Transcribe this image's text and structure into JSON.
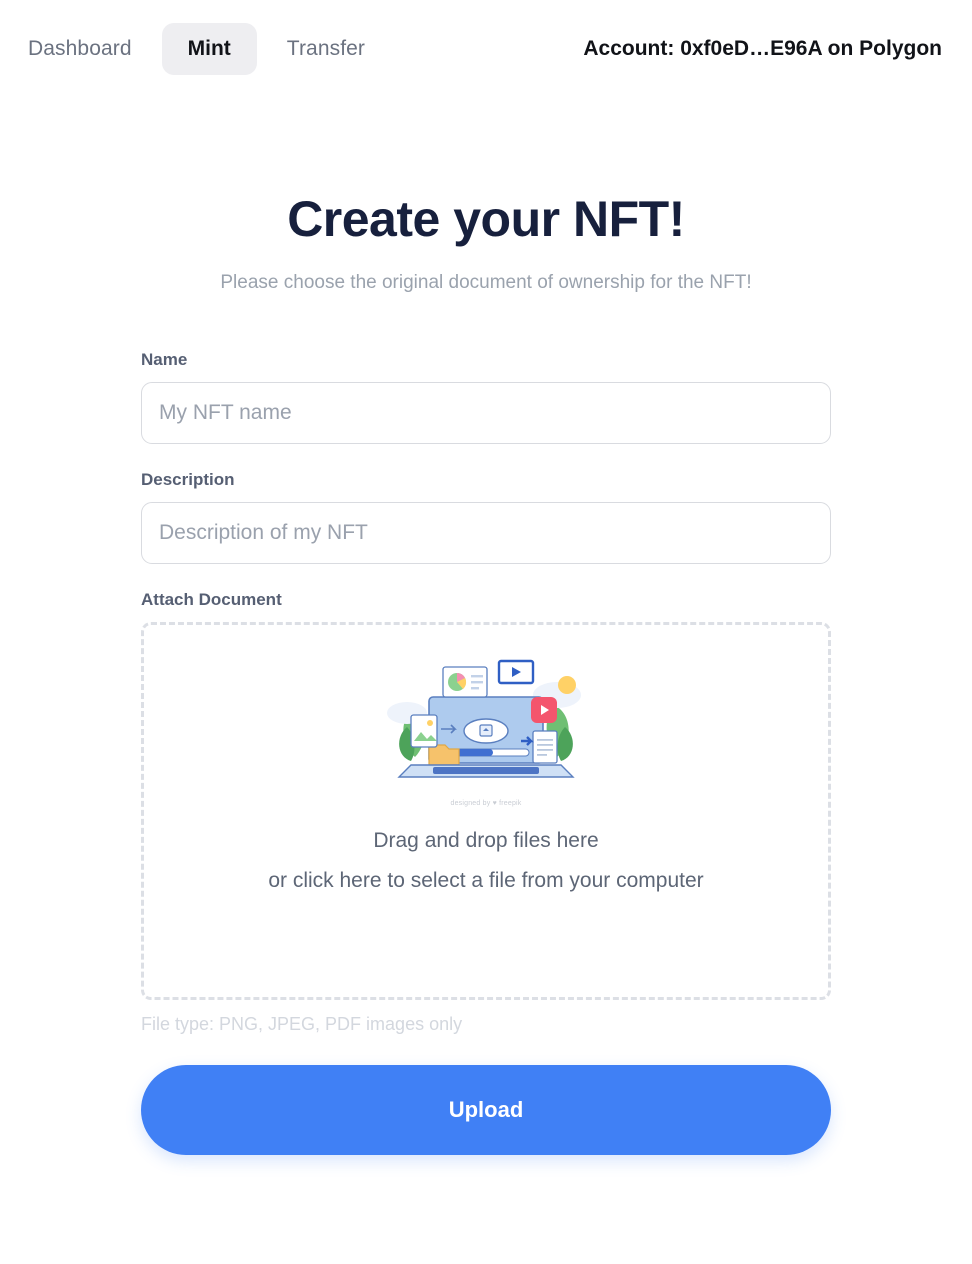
{
  "nav": {
    "links": [
      {
        "label": "Dashboard",
        "active": false
      },
      {
        "label": "Mint",
        "active": true
      },
      {
        "label": "Transfer",
        "active": false
      }
    ],
    "account": "Account: 0xf0eD…E96A on Polygon"
  },
  "hero": {
    "title": "Create your NFT!",
    "subtitle": "Please choose the original document of ownership for the NFT!"
  },
  "form": {
    "name": {
      "label": "Name",
      "placeholder": "My NFT name",
      "value": ""
    },
    "description": {
      "label": "Description",
      "placeholder": "Description of my NFT",
      "value": ""
    },
    "attach": {
      "label": "Attach Document",
      "drop_line1": "Drag and drop files here",
      "drop_line2": "or click here to select a file from your computer",
      "illustration_credit": "designed by ♥ freepik",
      "hint": "File type: PNG, JPEG, PDF images only"
    },
    "submit_label": "Upload"
  },
  "colors": {
    "accent": "#4080f5",
    "title": "#17203d",
    "muted": "#9aa2ad",
    "border": "#d9dbe0",
    "dashed_border": "#dcdfe5",
    "pill_bg": "#eeeef1"
  }
}
